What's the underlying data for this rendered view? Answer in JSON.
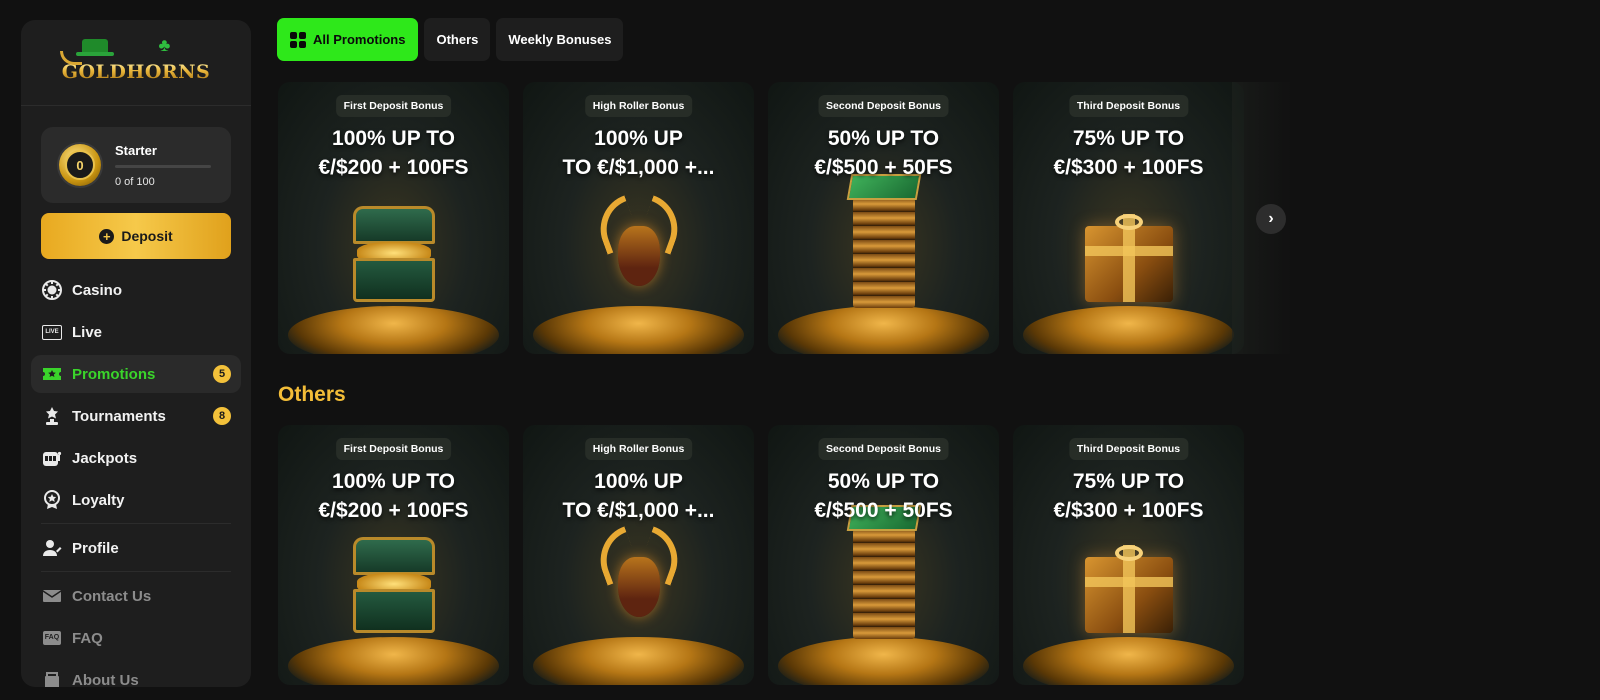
{
  "brand": {
    "logo_text": "GOLDHORNS"
  },
  "level": {
    "name": "Starter",
    "coin_digit": "0",
    "progress": "0 of 100",
    "progress_fraction": 0
  },
  "deposit": {
    "label": "Deposit",
    "icon": "plus-icon"
  },
  "nav": {
    "casino": {
      "label": "Casino",
      "icon": "casino-chip-icon"
    },
    "live": {
      "label": "Live",
      "icon": "live-icon",
      "icon_text": "LIVE"
    },
    "promotions": {
      "label": "Promotions",
      "icon": "ticket-icon",
      "badge": "5",
      "active": true
    },
    "tournaments": {
      "label": "Tournaments",
      "icon": "trophy-icon",
      "badge": "8"
    },
    "jackpots": {
      "label": "Jackpots",
      "icon": "slot-machine-icon"
    },
    "loyalty": {
      "label": "Loyalty",
      "icon": "medal-icon"
    },
    "profile": {
      "label": "Profile",
      "icon": "user-icon"
    },
    "contact": {
      "label": "Contact Us",
      "icon": "mail-icon"
    },
    "faq": {
      "label": "FAQ",
      "icon": "faq-icon",
      "icon_text": "FAQ"
    },
    "about": {
      "label": "About Us",
      "icon": "info-icon"
    }
  },
  "tabs": {
    "all": {
      "label": "All Promotions",
      "active": true
    },
    "others": {
      "label": "Others"
    },
    "weekly": {
      "label": "Weekly Bonuses"
    }
  },
  "section": {
    "others_title": "Others"
  },
  "promotions": [
    {
      "tag": "First Deposit Bonus",
      "line1": "100% UP TO",
      "line2": "€/$200 + 100FS",
      "art": "treasure-chest"
    },
    {
      "tag": "High Roller Bonus",
      "line1": "100% UP",
      "line2": "TO €/$1,000 +...",
      "art": "golden-bull"
    },
    {
      "tag": "Second Deposit Bonus",
      "line1": "50% UP TO",
      "line2": "€/$500 + 50FS",
      "art": "gold-bar-stack"
    },
    {
      "tag": "Third Deposit Bonus",
      "line1": "75% UP TO",
      "line2": "€/$300 + 100FS",
      "art": "gift-box"
    }
  ],
  "others": [
    {
      "tag": "First Deposit Bonus",
      "line1": "100% UP TO",
      "line2": "€/$200 + 100FS",
      "art": "treasure-chest"
    },
    {
      "tag": "High Roller Bonus",
      "line1": "100% UP",
      "line2": "TO €/$1,000 +...",
      "art": "golden-bull"
    },
    {
      "tag": "Second Deposit Bonus",
      "line1": "50% UP TO",
      "line2": "€/$500 + 50FS",
      "art": "gold-bar-stack"
    },
    {
      "tag": "Third Deposit Bonus",
      "line1": "75% UP TO",
      "line2": "€/$300 + 100FS",
      "art": "gift-box"
    }
  ],
  "carousel": {
    "next_icon": "chevron-right-icon",
    "next_glyph": "›"
  },
  "colors": {
    "accent_green": "#2ee81a",
    "gold": "#f3bd38",
    "badge": "#f3c13a",
    "background": "#111111",
    "sidebar": "#1e1e1e"
  }
}
